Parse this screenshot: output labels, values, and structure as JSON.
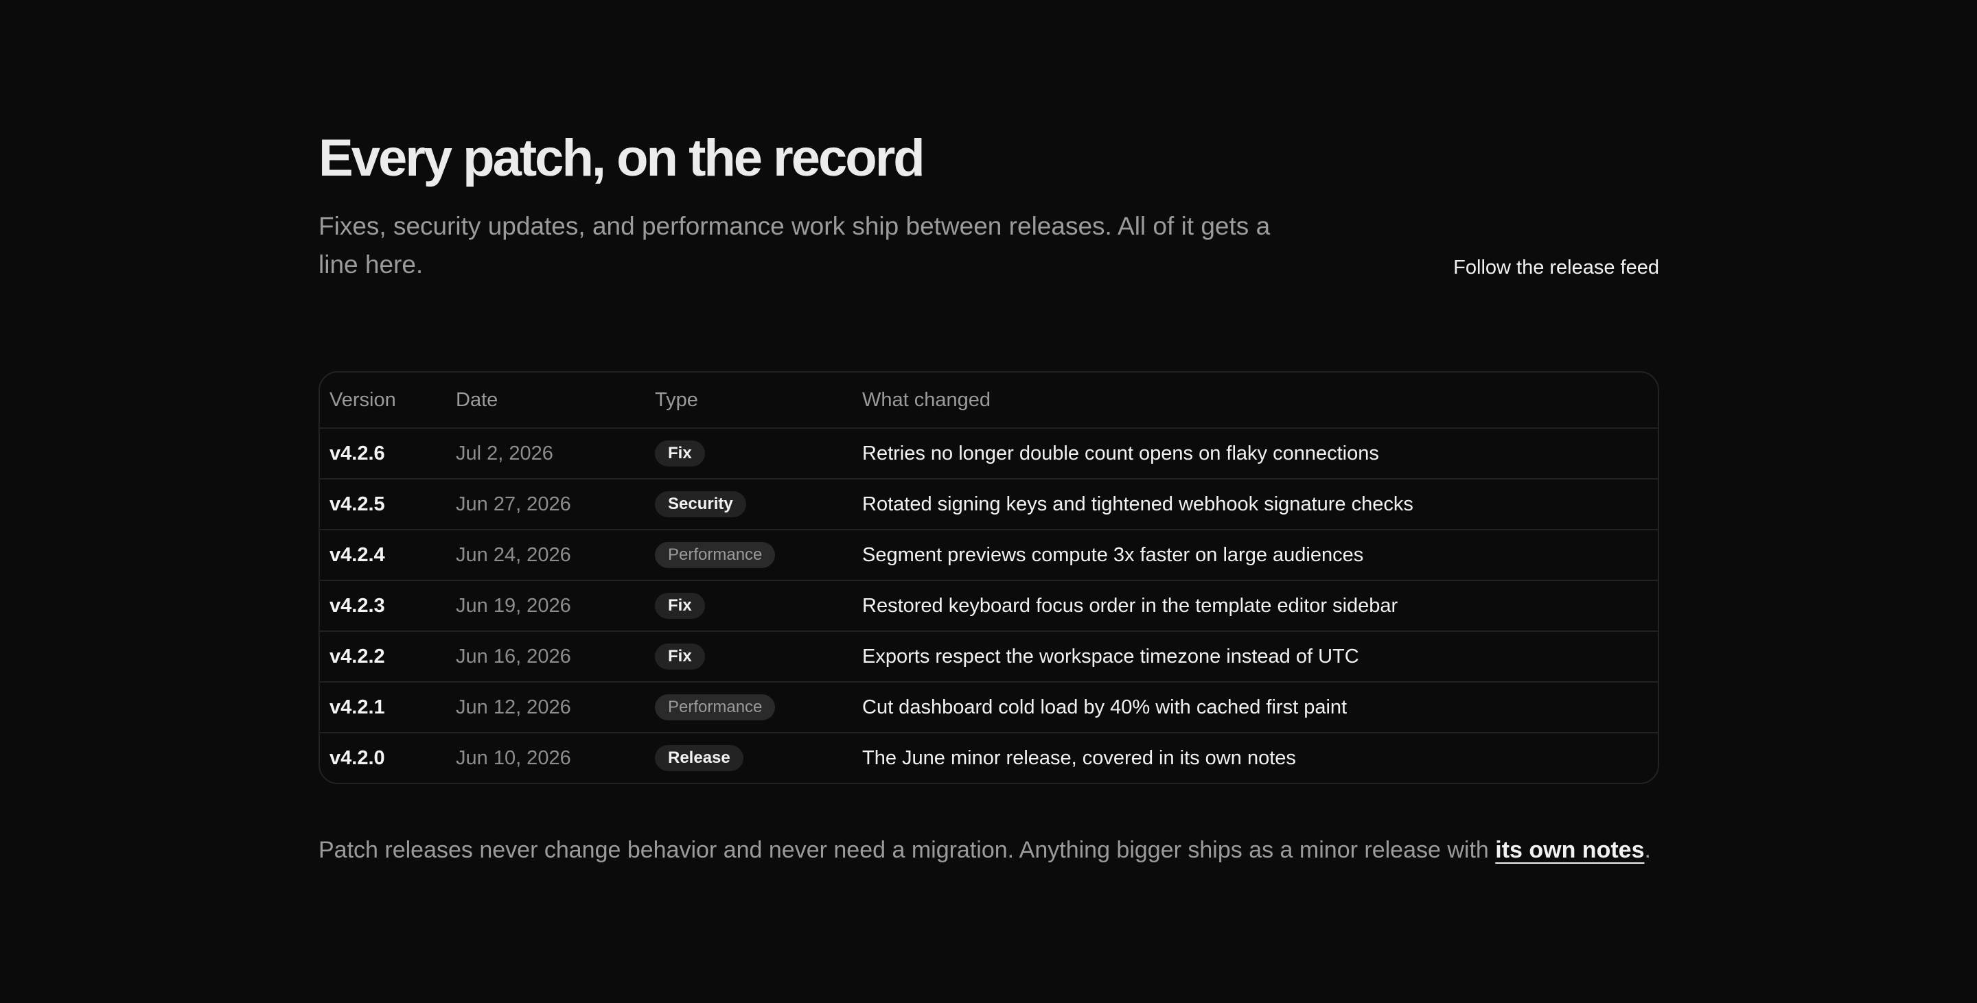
{
  "hero": {
    "title": "Every patch, on the record",
    "subtitle": "Fixes, security updates, and performance work ship between releases. All of it gets a line here.",
    "feed_link": "Follow the release feed"
  },
  "table": {
    "headers": [
      "Version",
      "Date",
      "Type",
      "What changed"
    ],
    "rows": [
      {
        "version": "v4.2.6",
        "date": "Jul 2, 2026",
        "type": "Fix",
        "what": "Retries no longer double count opens on flaky connections"
      },
      {
        "version": "v4.2.5",
        "date": "Jun 27, 2026",
        "type": "Security",
        "what": "Rotated signing keys and tightened webhook signature checks"
      },
      {
        "version": "v4.2.4",
        "date": "Jun 24, 2026",
        "type": "Performance",
        "what": "Segment previews compute 3x faster on large audiences"
      },
      {
        "version": "v4.2.3",
        "date": "Jun 19, 2026",
        "type": "Fix",
        "what": "Restored keyboard focus order in the template editor sidebar"
      },
      {
        "version": "v4.2.2",
        "date": "Jun 16, 2026",
        "type": "Fix",
        "what": "Exports respect the workspace timezone instead of UTC"
      },
      {
        "version": "v4.2.1",
        "date": "Jun 12, 2026",
        "type": "Performance",
        "what": "Cut dashboard cold load by 40% with cached first paint"
      },
      {
        "version": "v4.2.0",
        "date": "Jun 10, 2026",
        "type": "Release",
        "what": "The June minor release, covered in its own notes"
      }
    ]
  },
  "footer": {
    "note_text": "Patch releases never change behavior and never need a migration. Anything bigger ships as a minor release with ",
    "note_link": "its own notes",
    "note_end": "."
  },
  "colors": {
    "background": "#0b0b0b",
    "text": "#f2f2f2",
    "muted": "#9b9b9b",
    "badge_bg": "#232323"
  }
}
